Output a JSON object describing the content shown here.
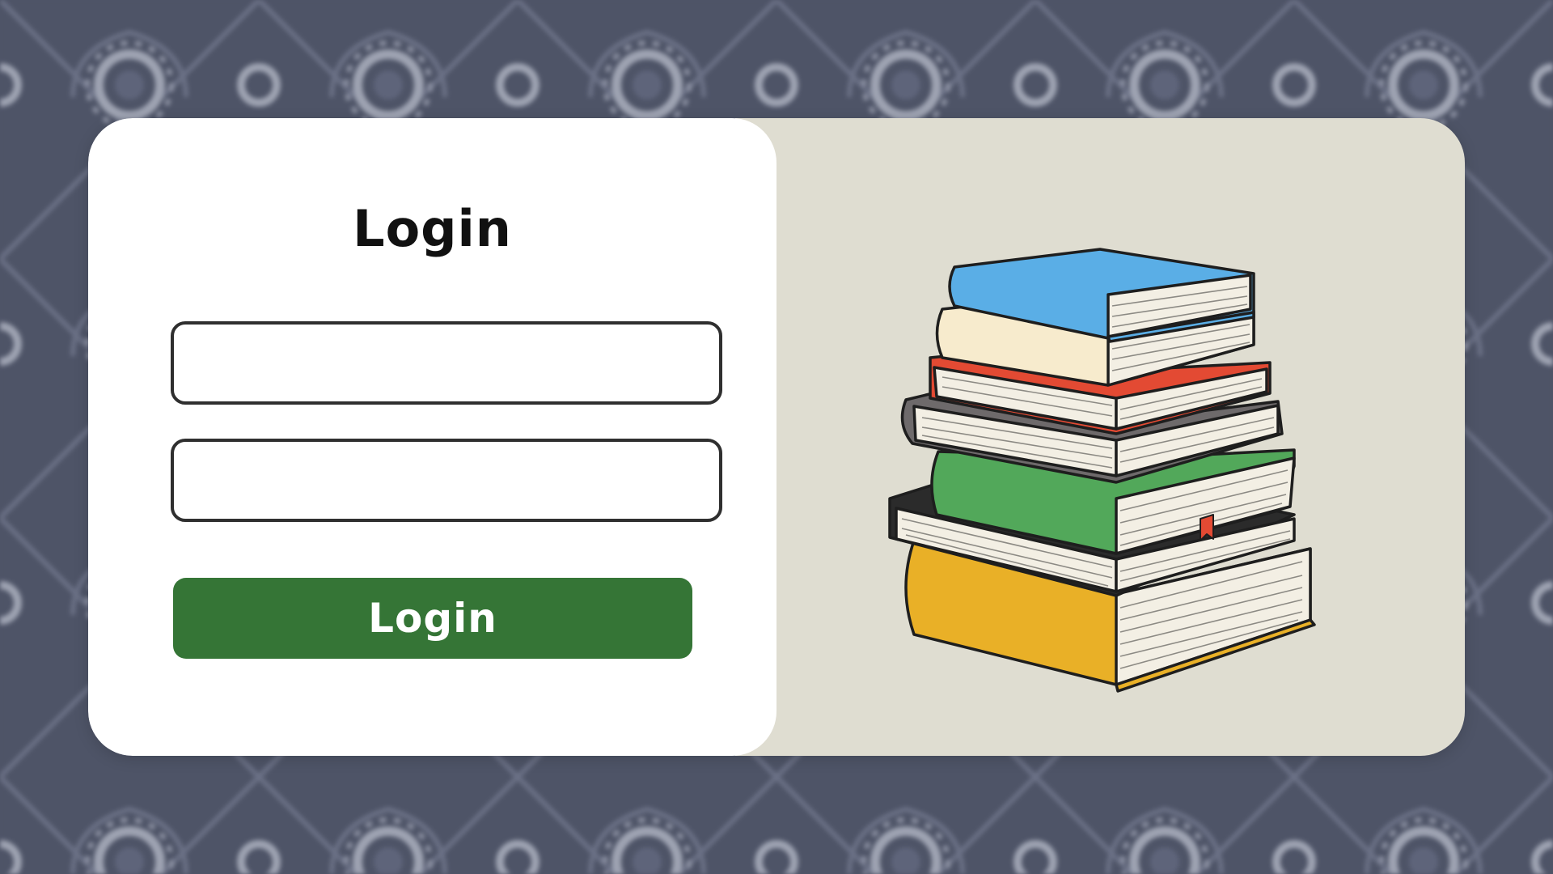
{
  "login_card": {
    "title": "Login",
    "username_placeholder": "",
    "password_placeholder": "",
    "submit_label": "Login"
  },
  "illustration": {
    "icon": "stack-of-books",
    "book_colors": [
      "#5aaee6",
      "#f7ebcd",
      "#e34a33",
      "#6e6a6b",
      "#52a85a",
      "#2b2b2b",
      "#e9b027"
    ]
  },
  "colors": {
    "background": "#4e5467",
    "accent": "#357536",
    "art_panel": "#dfddd1"
  }
}
